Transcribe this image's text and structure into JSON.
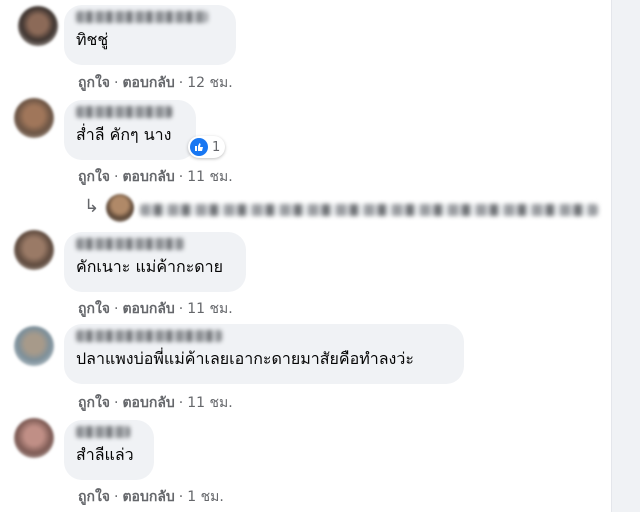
{
  "comments": [
    {
      "text": "ทิชชู่",
      "like": "ถูกใจ",
      "reply": "ตอบกลับ",
      "sep": "·",
      "time": "12 ชม."
    },
    {
      "text": "ส่ำลี คักๆ นาง",
      "like": "ถูกใจ",
      "reply": "ตอบกลับ",
      "sep": "·",
      "time": "11 ชม.",
      "reaction_count": "1"
    },
    {
      "text": "คักเนาะ แม่ค้ากะดาย",
      "like": "ถูกใจ",
      "reply": "ตอบกลับ",
      "sep": "·",
      "time": "11 ชม."
    },
    {
      "text": "ปลาแพงบ่อพี่แม่ค้าเลยเอากะดายมาสัยคือทำลงว่ะ",
      "like": "ถูกใจ",
      "reply": "ตอบกลับ",
      "sep": "·",
      "time": "11 ชม."
    },
    {
      "text": "สำลีแล่ว",
      "like": "ถูกใจ",
      "reply": "ตอบกลับ",
      "sep": "·",
      "time": "1 ชม."
    }
  ],
  "reply_row": {
    "arrow": "↳"
  },
  "colors": {
    "bubble": "#f0f2f5",
    "like_blue": "#1877f2",
    "meta": "#65676b"
  },
  "icons": {
    "reaction": "like-thumb-icon",
    "reply": "reply-arrow-icon"
  }
}
